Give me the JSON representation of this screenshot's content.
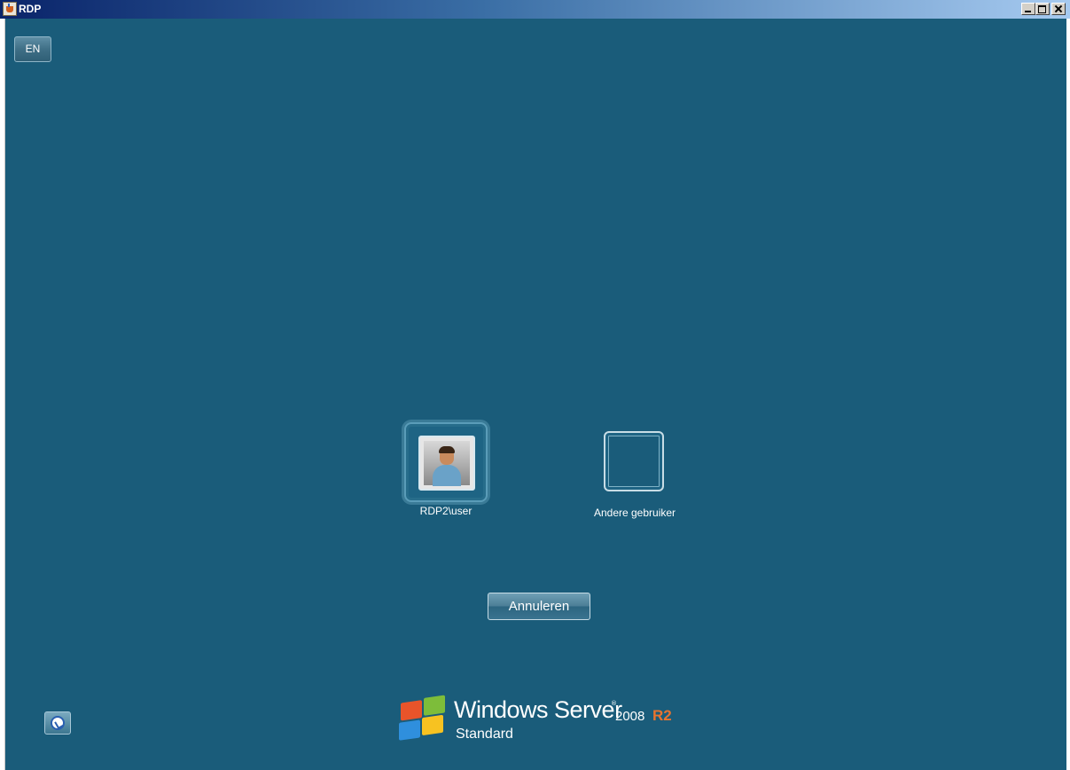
{
  "window": {
    "title": "RDP",
    "icon": "java-cup-icon",
    "controls": [
      "minimize",
      "maximize",
      "close"
    ]
  },
  "desktop": {
    "background_color": "#1a5c7a",
    "language_indicator": "EN"
  },
  "tiles": [
    {
      "label": "RDP2\\user",
      "icon": "user-avatar-icon"
    },
    {
      "label": "Andere gebruiker",
      "icon": "blank-user-frame-icon"
    }
  ],
  "actions": {
    "cancel_label": "Annuleren"
  },
  "ease_of_access": {
    "icon": "ease-of-access-icon"
  },
  "branding": {
    "product": "Windows Server",
    "trademark": "®",
    "year": "2008",
    "release": "R2",
    "edition": "Standard",
    "accent_color": "#e8732e"
  }
}
